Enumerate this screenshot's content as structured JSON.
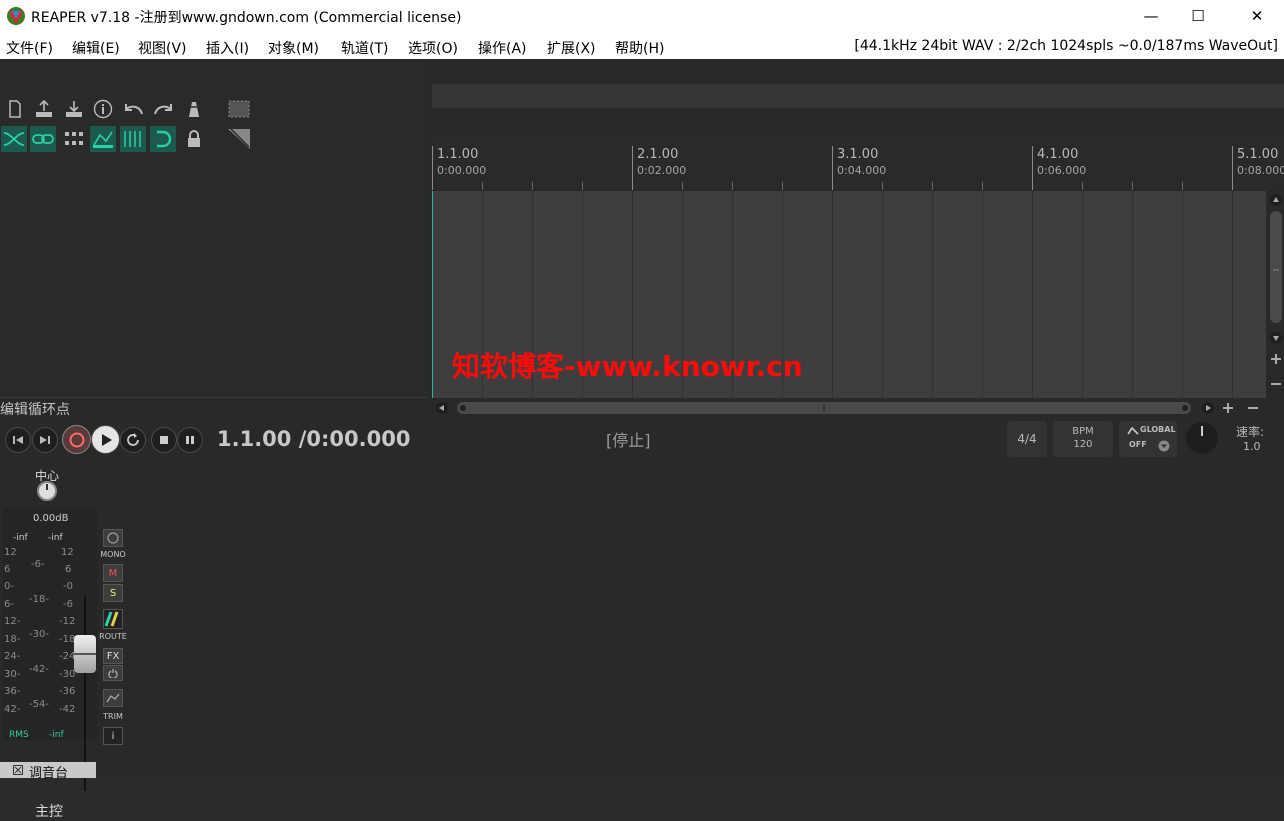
{
  "window": {
    "title": "REAPER v7.18 -注册到www.gndown.com (Commercial license)",
    "minimize": "—",
    "maximize": "☐",
    "close": "✕"
  },
  "menu": {
    "items": [
      "文件(F)",
      "编辑(E)",
      "视图(V)",
      "插入(I)",
      "对象(M)",
      "轨道(T)",
      "选项(O)",
      "操作(A)",
      "扩展(X)",
      "帮助(H)"
    ],
    "status": "[44.1kHz 24bit WAV : 2/2ch 1024spls ~0.0/187ms WaveOut]"
  },
  "ruler": {
    "measures": [
      "1.1.00",
      "2.1.00",
      "3.1.00",
      "4.1.00",
      "5.1.00"
    ],
    "times": [
      "0:00.000",
      "0:02.000",
      "0:04.000",
      "0:06.000",
      "0:08.000"
    ]
  },
  "editloop_label": "编辑循环点",
  "transport": {
    "timecode": "1.1.00 /0:00.000",
    "status": "[停止]",
    "timesig": "4/4",
    "bpm_label": "BPM",
    "bpm": "120",
    "global_label": "GLOBAL",
    "global_state": "OFF",
    "rate_label": "速率:",
    "rate": "1.0"
  },
  "mixer": {
    "pan_label": "中心",
    "volume": "0.00dB",
    "peak_left": "-inf",
    "peak_right": "-inf",
    "scale_left": [
      "12",
      "6",
      "0-",
      "6-",
      "12-",
      "18-",
      "24-",
      "30-",
      "36-",
      "42-"
    ],
    "scale_mid": [
      "-6-",
      "-18-",
      "-30-",
      "-42-",
      "-54-"
    ],
    "scale_right": [
      "12",
      "6",
      "-0",
      "-6",
      "-12",
      "-18",
      "-24",
      "-30",
      "-36",
      "-42"
    ],
    "rms_label": "RMS",
    "rms_value": "-inf",
    "master_label": "主控",
    "mono_label": "MONO",
    "mute_label": "M",
    "solo_label": "S",
    "route_label": "ROUTE",
    "fx_label": "FX",
    "trim_label": "TRIM",
    "info_label": "i",
    "tab_label": "调音台"
  },
  "watermark": "知软博客-www.knowr.cn",
  "colors": {
    "accent_teal": "#1d9a7f",
    "record_red": "#d44",
    "watermark_red": "#ff0a0a"
  }
}
